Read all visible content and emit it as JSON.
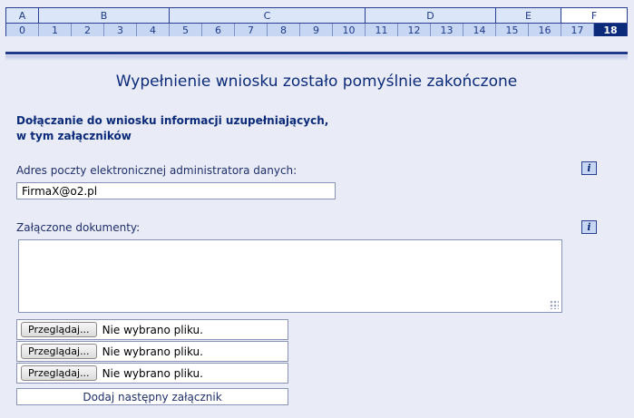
{
  "step_nav": {
    "groups": [
      {
        "letter": "A",
        "span": 1
      },
      {
        "letter": "B",
        "span": 4
      },
      {
        "letter": "C",
        "span": 6
      },
      {
        "letter": "D",
        "span": 4
      },
      {
        "letter": "E",
        "span": 2
      },
      {
        "letter": "F",
        "span": 2
      }
    ],
    "steps": [
      "0",
      "1",
      "2",
      "3",
      "4",
      "5",
      "6",
      "7",
      "8",
      "9",
      "10",
      "11",
      "12",
      "13",
      "14",
      "15",
      "16",
      "17",
      "18"
    ],
    "current_group": "F",
    "current_step": "18"
  },
  "main": {
    "title": "Wypełnienie wniosku zostało pomyślnie zakończone",
    "subtitle_line1": "Dołączanie do wniosku informacji uzupełniających,",
    "subtitle_line2": "w tym załączników",
    "email_label": "Adres poczty elektronicznej administratora danych:",
    "email_value": "FirmaX@o2.pl",
    "attachments_label": "Załączone dokumenty:",
    "info_icon_text": "i",
    "files": [
      {
        "button": "Przeglądaj...",
        "status": "Nie wybrano pliku."
      },
      {
        "button": "Przeglądaj...",
        "status": "Nie wybrano pliku."
      },
      {
        "button": "Przeglądaj...",
        "status": "Nie wybrano pliku."
      }
    ],
    "add_attachment_label": "Dodaj następny załącznik"
  }
}
